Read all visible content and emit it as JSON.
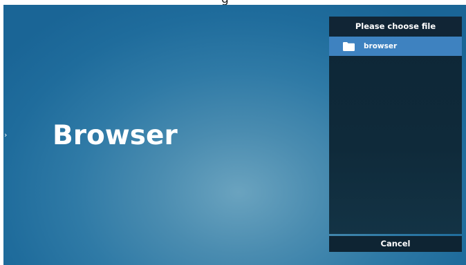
{
  "app": {
    "title": "Browser",
    "edge_arrow": "›"
  },
  "top_partial_text": "g",
  "file_dialog": {
    "header": "Please choose file",
    "items": [
      {
        "name": "browser",
        "icon": "folder-icon",
        "selected": true
      }
    ],
    "cancel_label": "Cancel"
  },
  "colors": {
    "background_edge": "#1a6596",
    "background_center": "#6aa3bf",
    "panel_bg": "#0f2a3a",
    "selected_row": "#3e82c0",
    "text": "#ffffff"
  }
}
